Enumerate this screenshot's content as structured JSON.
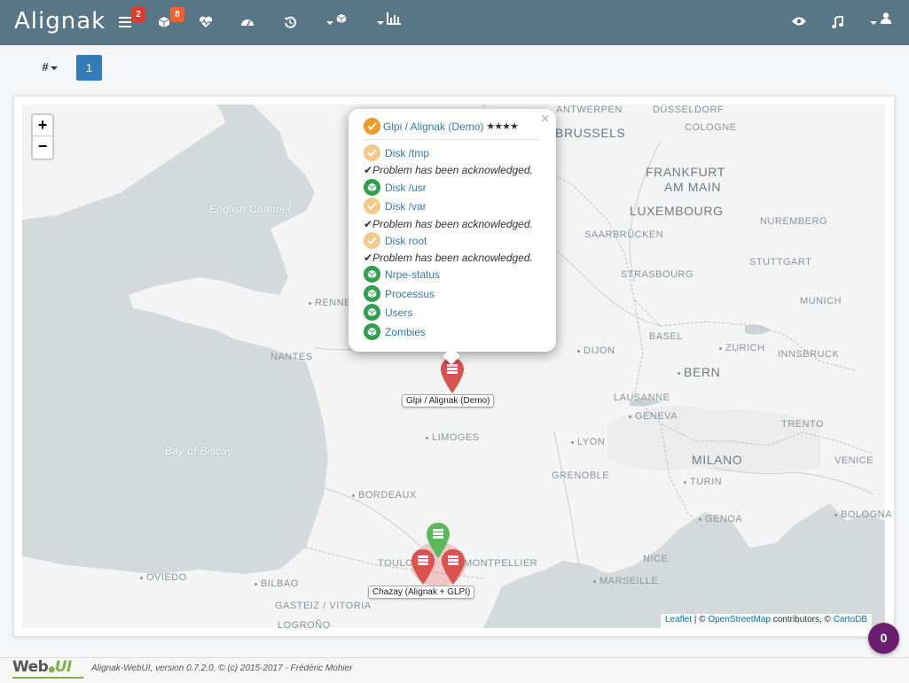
{
  "brand": "Alignak",
  "nav": {
    "problems_badge": "2",
    "impacts_badge": "8",
    "icons": [
      "problems-list-icon",
      "impacts-icon",
      "heartbeat-icon",
      "dashboard-icon",
      "history-icon",
      "groups-dropdown-icon",
      "reports-dropdown-icon",
      "eye-icon",
      "music-icon",
      "user-dropdown-icon"
    ]
  },
  "toolbar": {
    "hash_label": "#",
    "page": "1"
  },
  "map": {
    "zoom_in": "+",
    "zoom_out": "−",
    "labels": {
      "english_channel": "English Channel",
      "bay_of_biscay": "Bay of Biscay",
      "antwerpen": "ANTWERPEN",
      "dusseldorf": "DÜSSELDORF",
      "brussels": "BRUSSELS",
      "cologne": "COLOGNE",
      "frankfurt": "FRANKFURT",
      "am_main": "AM MAIN",
      "luxembourg": "LUXEMBOURG",
      "nuremberg": "NUREMBERG",
      "saarbrucken": "SAARBRÜCKEN",
      "stuttgart": "STUTTGART",
      "strasbourg": "STRASBOURG",
      "rennes": "RENNES",
      "munich": "MUNICH",
      "basel": "BASEL",
      "zurich": "ZURICH",
      "nantes": "NANTES",
      "dijon": "DIJON",
      "bern": "BERN",
      "innsbruck": "INNSBRUCK",
      "lausanne": "LAUSANNE",
      "geneva": "GENEVA",
      "limoges": "LIMOGES",
      "lyon": "LYON",
      "trento": "TRENTO",
      "milano": "MILANO",
      "venice": "VENICE",
      "grenoble": "GRENOBLE",
      "turin": "TURIN",
      "bordeaux": "BORDEAUX",
      "genoa": "GENOA",
      "bologna": "BOLOGNA",
      "toulouse": "TOULOUSE",
      "montpellier": "MONTPELLIER",
      "nice": "NICE",
      "oviedo": "OVIEDO",
      "bilbao": "BILBAO",
      "marseille": "MARSEILLE",
      "gasteiz": "GASTEIZ / VITORIA",
      "logrono": "LOGROÑO"
    },
    "attribution": {
      "leaflet": "Leaflet",
      "sep1": " | © ",
      "osm": "OpenStreetMap",
      "mid": " contributors, © ",
      "carto": "CartoDB"
    }
  },
  "popup": {
    "host": "Glpi / Alignak (Demo)",
    "stars": "★★★★",
    "close": "×",
    "services": [
      {
        "name": "Disk /tmp",
        "state": "acknowledged"
      },
      {
        "name": "Disk /usr",
        "state": "ok"
      },
      {
        "name": "Disk /var",
        "state": "acknowledged"
      },
      {
        "name": "Disk root",
        "state": "acknowledged"
      },
      {
        "name": "Nrpe-status",
        "state": "ok"
      },
      {
        "name": "Processus",
        "state": "ok"
      },
      {
        "name": "Users",
        "state": "ok"
      },
      {
        "name": "Zombies",
        "state": "ok"
      }
    ],
    "ack_text": "Problem has been acknowledged."
  },
  "markers": {
    "glpi_label": "Glpi / Alignak (Demo)",
    "chazay_label": "Chazay (Alignak + GLPI)"
  },
  "counter": "0",
  "footer": {
    "logo_web": "Web",
    "logo_ui": "UI",
    "text": "Alignak-WebUI, version 0.7.2.0, © (c) 2015-2017 - Frédéric Mohier"
  },
  "colors": {
    "navbar": "#587685",
    "ok": "#2ca14a",
    "acknowledged": "#f5ca89",
    "warning": "#f29a23",
    "critical_marker": "#d9534f",
    "ok_marker": "#5cb85c",
    "counter": "#6c1e6e",
    "link": "#337ab7"
  }
}
